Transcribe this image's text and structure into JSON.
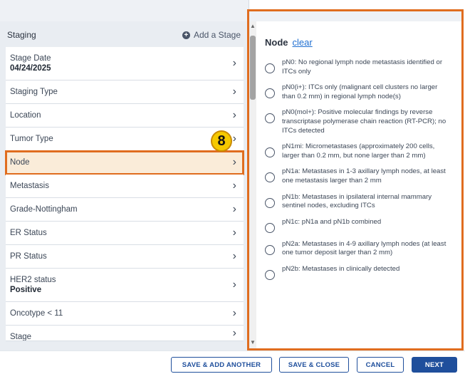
{
  "staging": {
    "title": "Staging",
    "add_stage_label": "Add a Stage",
    "items": [
      {
        "label": "Stage Date",
        "value": "04/24/2025"
      },
      {
        "label": "Staging Type"
      },
      {
        "label": "Location"
      },
      {
        "label": "Tumor Type"
      },
      {
        "label": "Node"
      },
      {
        "label": "Metastasis"
      },
      {
        "label": "Grade-Nottingham"
      },
      {
        "label": "ER Status"
      },
      {
        "label": "PR Status"
      },
      {
        "label": "HER2 status",
        "value": "Positive"
      },
      {
        "label": "Oncotype < 11"
      },
      {
        "label": "Stage"
      }
    ]
  },
  "step_badge": "8",
  "node_panel": {
    "title": "Node",
    "clear_label": "clear",
    "options": [
      "pN0: No regional lymph node metastasis identified or ITCs only",
      "pN0(i+): ITCs only (malignant cell clusters no larger than 0.2 mm) in regional lymph node(s)",
      "pN0(mol+): Positive molecular findings by reverse transcriptase polymerase chain reaction (RT-PCR); no ITCs detected",
      "pN1mi: Micrometastases (approximately 200 cells, larger than 0.2 mm, but none larger than 2 mm)",
      "pN1a: Metastases in 1-3 axillary lymph nodes, at least one metastasis larger than 2 mm",
      "pN1b: Metastases in ipsilateral internal mammary sentinel nodes, excluding ITCs",
      "pN1c: pN1a and pN1b combined",
      "pN2a: Metastases in 4-9 axillary lymph nodes (at least one tumor deposit larger than 2 mm)",
      "pN2b: Metastases in clinically detected"
    ]
  },
  "footer": {
    "save_add_another": "SAVE & ADD ANOTHER",
    "save_close": "SAVE & CLOSE",
    "cancel": "CANCEL",
    "next": "NEXT"
  },
  "colors": {
    "highlight": "#e06d1f",
    "selected_bg": "#faecd9",
    "link": "#1f6fd1",
    "primary": "#1f4f9c",
    "badge": "#f5c900"
  }
}
